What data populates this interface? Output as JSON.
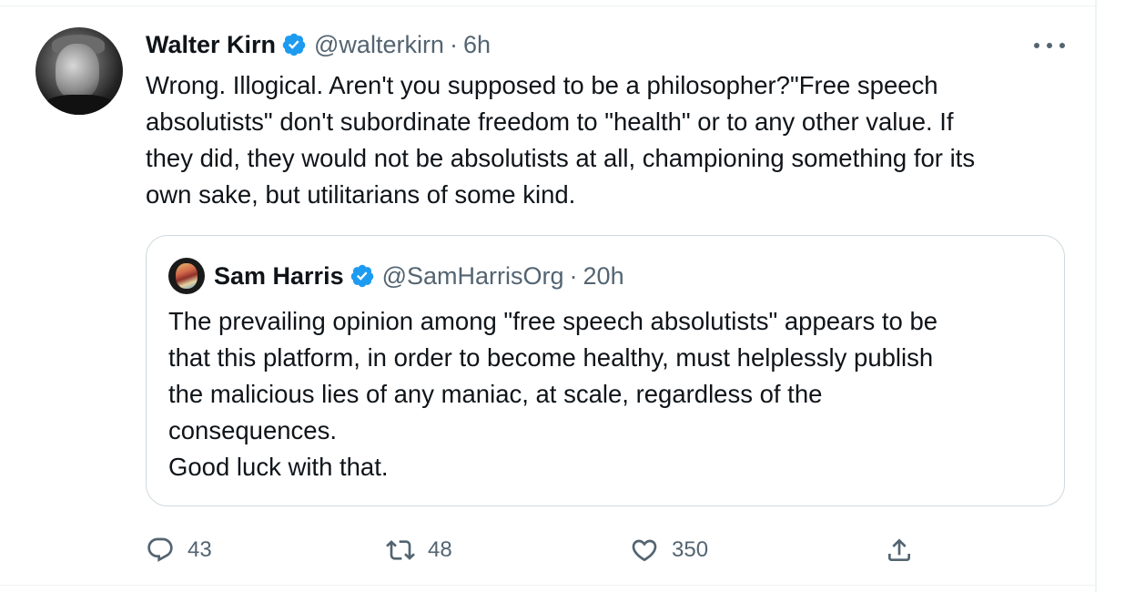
{
  "tweet": {
    "author_name": "Walter Kirn",
    "author_handle": "@walterkirn",
    "separator": "·",
    "time": "6h",
    "text_lines": [
      "Wrong. Illogical. Aren't you supposed to be a philosopher?\"Free speech",
      "absolutists\" don't subordinate freedom to \"health\" or to any other value. If",
      "they did, they would not be absolutists at all, championing something for its",
      "own sake, but utilitarians of some kind."
    ]
  },
  "quoted_tweet": {
    "author_name": "Sam Harris",
    "author_handle": "@SamHarrisOrg",
    "separator": "·",
    "time": "20h",
    "text_lines": [
      "The prevailing opinion among \"free speech absolutists\" appears to be",
      "that this platform, in order to become healthy, must helplessly publish",
      "the malicious lies of any maniac, at scale, regardless of the",
      "consequences.",
      "Good luck with that."
    ]
  },
  "actions": {
    "reply_count": "43",
    "retweet_count": "48",
    "like_count": "350"
  },
  "icons": {
    "verified": "verified-badge-icon",
    "more": "more-options-icon",
    "reply": "reply-icon",
    "retweet": "retweet-icon",
    "like": "heart-icon",
    "share": "share-icon"
  },
  "colors": {
    "verified_blue": "#1d9bf0",
    "secondary_text": "#536471",
    "primary_text": "#0f1419",
    "border": "#cfd9de"
  }
}
